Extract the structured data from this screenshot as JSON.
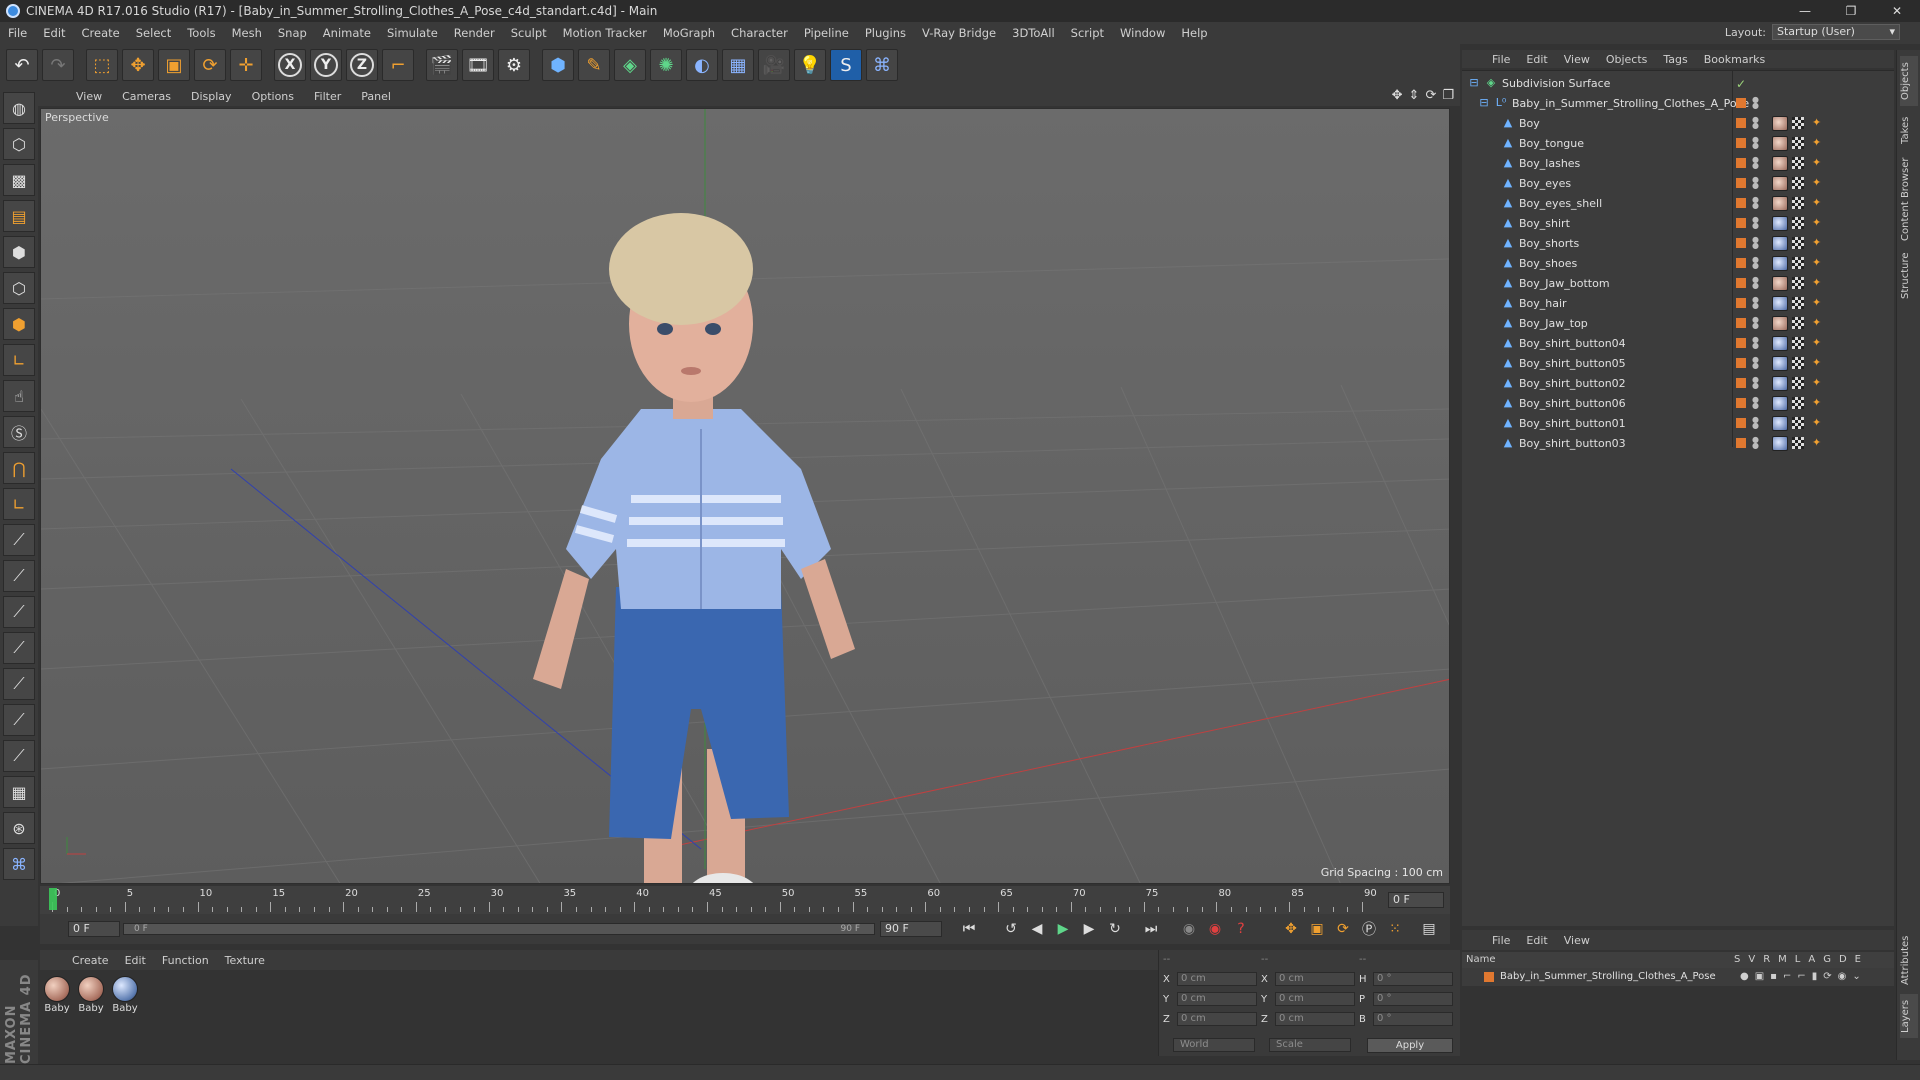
{
  "window": {
    "title": "CINEMA 4D R17.016 Studio (R17) - [Baby_in_Summer_Strolling_Clothes_A_Pose_c4d_standart.c4d] - Main"
  },
  "menubar": {
    "items": [
      "File",
      "Edit",
      "Create",
      "Select",
      "Tools",
      "Mesh",
      "Snap",
      "Animate",
      "Simulate",
      "Render",
      "Sculpt",
      "Motion Tracker",
      "MoGraph",
      "Character",
      "Pipeline",
      "Plugins",
      "V-Ray Bridge",
      "3DToAll",
      "Script",
      "Window",
      "Help"
    ],
    "layout_label": "Layout:",
    "layout_value": "Startup (User)"
  },
  "toolbar": {
    "icons": [
      "undo-icon",
      "redo-icon",
      "live-selection-icon",
      "move-icon",
      "scale-icon",
      "rotate-icon",
      "last-tool-icon",
      "x-axis-icon",
      "y-axis-icon",
      "z-axis-icon",
      "coordinate-system-icon",
      "render-view-icon",
      "render-picture-viewer-icon",
      "edit-render-settings-icon",
      "cube-icon",
      "pen-spline-icon",
      "subdivision-surface-icon",
      "array-icon",
      "deformer-icon",
      "floor-icon",
      "camera-icon",
      "light-icon",
      "vray-icon",
      "python-icon"
    ],
    "axis_labels": [
      "X",
      "Y",
      "Z"
    ]
  },
  "viewport": {
    "menu": [
      "View",
      "Cameras",
      "Display",
      "Options",
      "Filter",
      "Panel"
    ],
    "camera_label": "Perspective",
    "grid_spacing": "Grid Spacing : 100 cm"
  },
  "timeline": {
    "ticks": [
      "0",
      "5",
      "10",
      "15",
      "20",
      "25",
      "30",
      "35",
      "40",
      "45",
      "50",
      "55",
      "60",
      "65",
      "70",
      "75",
      "80",
      "85",
      "90"
    ],
    "current_frame": "0 F",
    "start_field": "0 F",
    "slider_start": "0 F",
    "slider_end": "90 F",
    "end_field": "90 F"
  },
  "material_manager": {
    "menu": [
      "Create",
      "Edit",
      "Function",
      "Texture"
    ],
    "materials": [
      "Baby",
      "Baby",
      "Baby"
    ]
  },
  "coordinates": {
    "header": [
      "--",
      "--",
      "--"
    ],
    "rows": [
      {
        "a": "X",
        "a_val": "0 cm",
        "b": "X",
        "b_val": "0 cm",
        "c": "H",
        "c_val": "0 °"
      },
      {
        "a": "Y",
        "a_val": "0 cm",
        "b": "Y",
        "b_val": "0 cm",
        "c": "P",
        "c_val": "0 °"
      },
      {
        "a": "Z",
        "a_val": "0 cm",
        "b": "Z",
        "b_val": "0 cm",
        "c": "B",
        "c_val": "0 °"
      }
    ],
    "mode_world": "World",
    "mode_scale": "Scale",
    "apply_label": "Apply"
  },
  "object_manager": {
    "menu": [
      "File",
      "Edit",
      "View",
      "Objects",
      "Tags",
      "Bookmarks"
    ],
    "root": "Subdivision Surface",
    "group": "Baby_in_Summer_Strolling_Clothes_A_Pose",
    "objects": [
      {
        "name": "Boy",
        "mat": "skin"
      },
      {
        "name": "Boy_tongue",
        "mat": "skin"
      },
      {
        "name": "Boy_lashes",
        "mat": "skin"
      },
      {
        "name": "Boy_eyes",
        "mat": "skin"
      },
      {
        "name": "Boy_eyes_shell",
        "mat": "skin"
      },
      {
        "name": "Boy_shirt",
        "mat": "blue"
      },
      {
        "name": "Boy_shorts",
        "mat": "blue"
      },
      {
        "name": "Boy_shoes",
        "mat": "blue"
      },
      {
        "name": "Boy_Jaw_bottom",
        "mat": "skin"
      },
      {
        "name": "Boy_hair",
        "mat": "blue"
      },
      {
        "name": "Boy_Jaw_top",
        "mat": "skin"
      },
      {
        "name": "Boy_shirt_button04",
        "mat": "blue"
      },
      {
        "name": "Boy_shirt_button05",
        "mat": "blue"
      },
      {
        "name": "Boy_shirt_button02",
        "mat": "blue"
      },
      {
        "name": "Boy_shirt_button06",
        "mat": "blue"
      },
      {
        "name": "Boy_shirt_button01",
        "mat": "blue"
      },
      {
        "name": "Boy_shirt_button03",
        "mat": "blue"
      }
    ]
  },
  "layer_manager": {
    "menu": [
      "File",
      "Edit",
      "View"
    ],
    "name_header": "Name",
    "columns": [
      "S",
      "V",
      "R",
      "M",
      "L",
      "A",
      "G",
      "D",
      "E"
    ],
    "layer_name": "Baby_in_Summer_Strolling_Clothes_A_Pose"
  },
  "right_tabs": [
    "Objects",
    "Takes",
    "Content Browser",
    "Structure",
    "Attributes",
    "Layers"
  ],
  "brand": "MAXON CINEMA 4D",
  "colors": {
    "layer_orange": "#e07830",
    "accent_blue": "#3c8be0"
  }
}
